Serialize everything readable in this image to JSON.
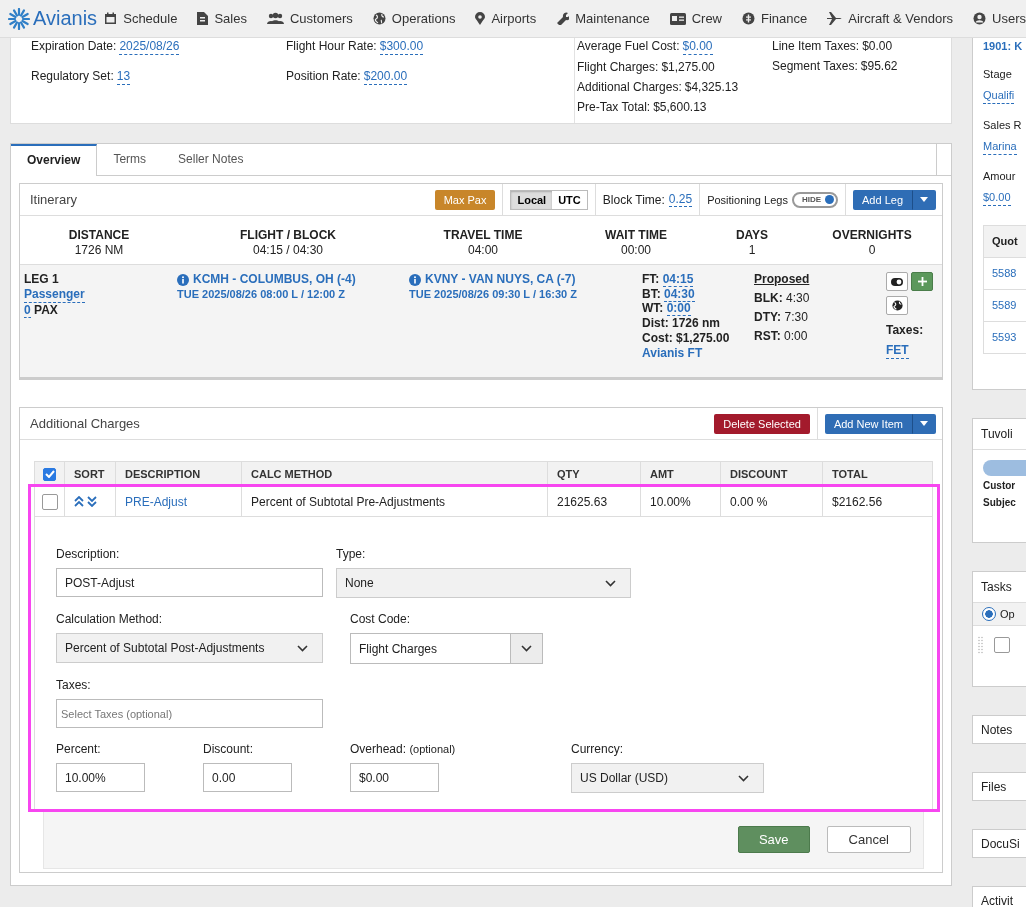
{
  "nav": {
    "logo": "Avianis",
    "items": [
      {
        "label": "Schedule"
      },
      {
        "label": "Sales"
      },
      {
        "label": "Customers"
      },
      {
        "label": "Operations"
      },
      {
        "label": "Airports"
      },
      {
        "label": "Maintenance"
      },
      {
        "label": "Crew"
      },
      {
        "label": "Finance"
      },
      {
        "label": "Aircraft & Vendors"
      },
      {
        "label": "Users"
      }
    ]
  },
  "summary": {
    "columns": [
      [
        {
          "label": "Expiration Date:",
          "value": "2025/08/26",
          "link": true
        },
        {
          "label": "Regulatory Set:",
          "value": "13",
          "link": true
        }
      ],
      [
        {
          "label": "Flight Hour Rate:",
          "value": "$300.00",
          "link": true
        },
        {
          "label": "Position Rate:",
          "value": "$200.00",
          "link": true
        }
      ],
      [
        {
          "label": "Average Fuel Cost:",
          "value": "$0.00",
          "link": true
        },
        {
          "label": "Flight Charges:",
          "value": "$1,275.00",
          "link": false
        },
        {
          "label": "Additional Charges:",
          "value": "$4,325.13",
          "link": false
        },
        {
          "label": "Pre-Tax Total:",
          "value": "$5,600.13",
          "link": false
        }
      ],
      [
        {
          "label": "Line Item Taxes:",
          "value": "$0.00",
          "link": false
        },
        {
          "label": "Segment Taxes:",
          "value": "$95.62",
          "link": false
        }
      ]
    ]
  },
  "tabs": [
    {
      "label": "Overview",
      "selected": true
    },
    {
      "label": "Terms",
      "selected": false
    },
    {
      "label": "Seller Notes",
      "selected": false
    }
  ],
  "itinerary": {
    "title": "Itinerary",
    "max_pax": "Max Pax",
    "time_modes": [
      {
        "label": "Local",
        "selected": true
      },
      {
        "label": "UTC",
        "selected": false
      }
    ],
    "block_time": {
      "label": "Block Time:",
      "value": "0.25"
    },
    "positioning_legs": {
      "label": "Positioning Legs",
      "toggle": "HIDE",
      "on": true
    },
    "add_leg": "Add Leg",
    "stats": [
      {
        "label": "DISTANCE",
        "value": "1726 NM"
      },
      {
        "label": "FLIGHT / BLOCK",
        "value": "04:15 / 04:30"
      },
      {
        "label": "TRAVEL TIME",
        "value": "04:00"
      },
      {
        "label": "WAIT TIME",
        "value": "00:00"
      },
      {
        "label": "DAYS",
        "value": "1"
      },
      {
        "label": "OVERNIGHTS",
        "value": "0"
      }
    ],
    "leg": {
      "title": "LEG 1",
      "type": "Passenger",
      "pax_count": "0",
      "pax_label": "PAX",
      "departure": {
        "airport": "KCMH - COLUMBUS, OH (-4)",
        "time": "TUE 2025/08/26 08:00 L / 12:00 Z"
      },
      "arrival": {
        "airport": "KVNY - VAN NUYS, CA (-7)",
        "time": "TUE 2025/08/26 09:30 L / 16:30 Z"
      },
      "times": [
        {
          "label": "FT:",
          "value": "04:15"
        },
        {
          "label": "BT:",
          "value": "04:30"
        },
        {
          "label": "WT:",
          "value": "0:00"
        }
      ],
      "distance": "Dist: 1726 nm",
      "cost": "Cost: $1,275.00",
      "calculator": "Avianis FT",
      "proposed": {
        "title": "Proposed",
        "rows": [
          {
            "label": "BLK:",
            "value": "4:30"
          },
          {
            "label": "DTY:",
            "value": "7:30"
          },
          {
            "label": "RST:",
            "value": "0:00"
          }
        ]
      },
      "taxes_label": "Taxes:",
      "tax": "FET"
    }
  },
  "charges": {
    "title": "Additional Charges",
    "delete": "Delete Selected",
    "add": "Add New Item",
    "all_checked": true,
    "columns": [
      "SORT",
      "DESCRIPTION",
      "CALC METHOD",
      "QTY",
      "AMT",
      "DISCOUNT",
      "TOTAL"
    ],
    "rows": [
      {
        "checked": false,
        "description": "PRE-Adjust",
        "calc_method": "Percent of Subtotal Pre-Adjustments",
        "qty": "21625.63",
        "amt": "10.00%",
        "discount": "0.00 %",
        "total": "$2162.56"
      }
    ],
    "form": {
      "description": {
        "label": "Description:",
        "value": "POST-Adjust"
      },
      "type": {
        "label": "Type:",
        "value": "None"
      },
      "calc_method": {
        "label": "Calculation Method:",
        "value": "Percent of Subtotal Post-Adjustments"
      },
      "cost_code": {
        "label": "Cost Code:",
        "value": "Flight Charges"
      },
      "taxes": {
        "label": "Taxes:",
        "placeholder": "Select Taxes (optional)"
      },
      "percent": {
        "label": "Percent:",
        "value": "10.00%"
      },
      "discount": {
        "label": "Discount:",
        "value": "0.00"
      },
      "overhead": {
        "label": "Overhead:",
        "note": "(optional)",
        "value": "$0.00"
      },
      "currency": {
        "label": "Currency:",
        "value": "US Dollar (USD)"
      },
      "save": "Save",
      "cancel": "Cancel"
    }
  },
  "sidebar": {
    "opportunity": {
      "number": "1901:",
      "name": "K",
      "fields": [
        {
          "label": "Stage",
          "value": "Qualifi"
        },
        {
          "label": "Sales R",
          "value": "Marina"
        },
        {
          "label": "Amour",
          "value": "$0.00"
        }
      ],
      "quotes_header": "Quot",
      "quotes": [
        "5588",
        "5589",
        "5593"
      ]
    },
    "tuvoli": {
      "title": "Tuvoli",
      "rows": [
        "Custor",
        "Subjec"
      ]
    },
    "tasks": {
      "title": "Tasks",
      "filter": {
        "label": "Op",
        "selected": true
      },
      "items": [
        {
          "checked": false
        }
      ]
    },
    "panels": [
      "Notes",
      "Files",
      "DocuSi",
      "Activit"
    ]
  }
}
